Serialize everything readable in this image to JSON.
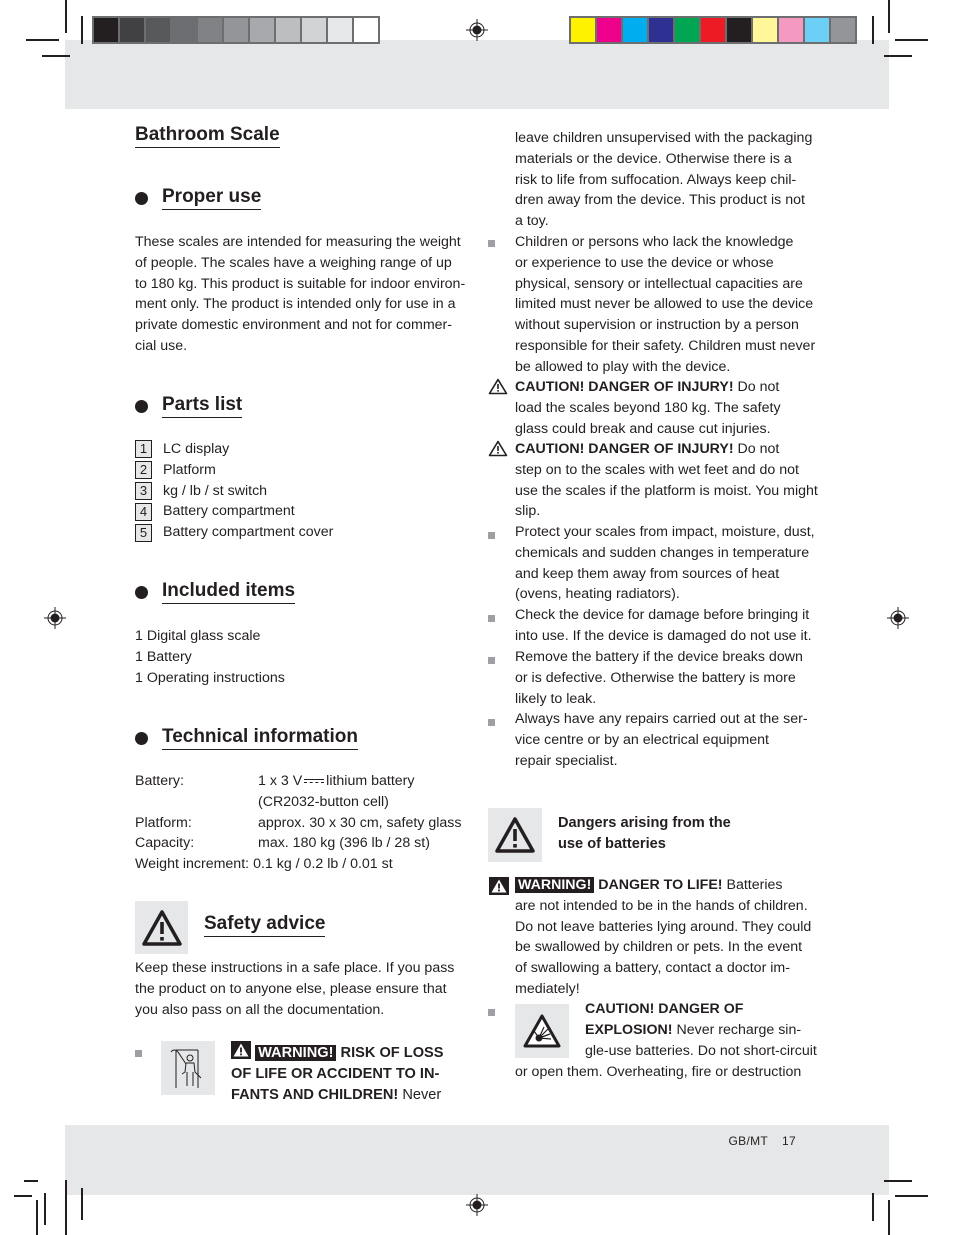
{
  "print_marks": {
    "gray_swatches": [
      "#231f20",
      "#414042",
      "#58595b",
      "#6d6e71",
      "#808285",
      "#939598",
      "#a7a9ac",
      "#bcbec0",
      "#d1d3d4",
      "#e6e7e8",
      "#ffffff"
    ],
    "color_swatches": [
      "#fff200",
      "#ec008c",
      "#00aeef",
      "#2e3192",
      "#00a651",
      "#ed1c24",
      "#231f20",
      "#fff799",
      "#f49ac1",
      "#6dcff6",
      "#939598"
    ]
  },
  "left": {
    "title": "Bathroom Scale",
    "proper_use": {
      "heading": "Proper use",
      "lines": [
        "These scales are intended for measuring the weight",
        "of people. The scales have a weighing range of up",
        "to 180 kg. This product is suitable for indoor environ-",
        "ment only. The product is intended only for use in a",
        "private domestic environment and not for commer-",
        "cial use."
      ]
    },
    "parts_list": {
      "heading": "Parts list",
      "items": [
        {
          "num": "1",
          "label": "LC display"
        },
        {
          "num": "2",
          "label": "Platform"
        },
        {
          "num": "3",
          "label": "kg / lb / st switch"
        },
        {
          "num": "4",
          "label": "Battery compartment"
        },
        {
          "num": "5",
          "label": "Battery compartment cover"
        }
      ]
    },
    "included_items": {
      "heading": "Included items",
      "items": [
        "1 Digital glass scale",
        "1 Battery",
        "1 Operating instructions"
      ]
    },
    "technical_information": {
      "heading": "Technical information",
      "battery_label": "Battery:",
      "battery_pre": "1 x 3 V",
      "battery_post": "lithium battery",
      "battery_line2": "(CR2032-button cell)",
      "rows": [
        {
          "key": "Platform:",
          "value": "approx. 30 x 30 cm, safety glass"
        },
        {
          "key": "Capacity:",
          "value": "max. 180 kg (396 lb / 28 st)"
        },
        {
          "key": "Weight increment:",
          "value": "0.1 kg / 0.2 lb / 0.01 st"
        }
      ]
    },
    "safety_advice": {
      "heading": "Safety advice",
      "lines": [
        "Keep these instructions in a safe place. If you pass",
        "the product on to anyone else, please ensure that",
        "you also pass on all the documentation."
      ],
      "warning_badge": "WARNING!",
      "warning_line1_rest": "RISK OF LOSS",
      "warning_line2": "OF LIFE OR ACCIDENT TO IN-",
      "warning_line3_bold": "FANTS AND CHILDREN!",
      "warning_line3_rest": "Never"
    }
  },
  "right": {
    "continued_lines": [
      "leave children unsupervised with the packaging",
      "materials or the device. Otherwise there is a",
      "risk to life from suffocation. Always keep chil-",
      "dren away from the device. This product is not",
      "a toy."
    ],
    "children_lines": [
      "Children or persons who lack the knowledge",
      "or experience to use the device or whose",
      "physical, sensory or intellectual capacities are",
      "limited must never be allowed to use the device",
      "without supervision or instruction by a person",
      "responsible for their safety. Children must never",
      "be allowed to play with the device."
    ],
    "caution1": {
      "bold": "CAUTION! DANGER OF INJURY!",
      "rest": "Do not",
      "lines": [
        "load the scales beyond 180 kg. The safety",
        "glass could break and cause cut injuries."
      ]
    },
    "caution2": {
      "bold": "CAUTION! DANGER OF INJURY!",
      "rest": "Do not",
      "lines": [
        "step on to the scales with wet feet and do not",
        "use the scales if the platform is moist. You might",
        "slip."
      ]
    },
    "bullets": [
      [
        "Protect your scales from impact, moisture, dust,",
        "chemicals and sudden changes in temperature",
        "and keep them away from sources of heat",
        "(ovens, heating radiators)."
      ],
      [
        "Check the device for damage before bringing it",
        "into use. If the device is damaged do not use it."
      ],
      [
        "Remove the battery if the device breaks down",
        "or is defective. Otherwise the battery is more",
        "likely to leak."
      ],
      [
        "Always have any repairs carried out at the ser-",
        "vice centre or by an electrical equipment",
        "repair specialist."
      ]
    ],
    "batteries_heading": [
      "Dangers arising from the",
      "use of batteries"
    ],
    "battery_warning": {
      "badge": "WARNING!",
      "bold": "DANGER TO LIFE!",
      "rest": "Batteries",
      "lines": [
        "are not intended to be in the hands of children.",
        "Do not leave batteries lying around. They could",
        "be swallowed by children or pets. In the event",
        "of swallowing a battery, contact a doctor im-",
        "mediately!"
      ]
    },
    "explosion": {
      "bold1": "CAUTION! DANGER OF",
      "bold2": "EXPLOSION!",
      "rest2": "Never recharge sin-",
      "line3": "gle-use batteries. Do not short-circuit",
      "line4": "or open them. Overheating, fire or destruction"
    }
  },
  "footer": {
    "locale": "GB/MT",
    "page_number": "17"
  }
}
